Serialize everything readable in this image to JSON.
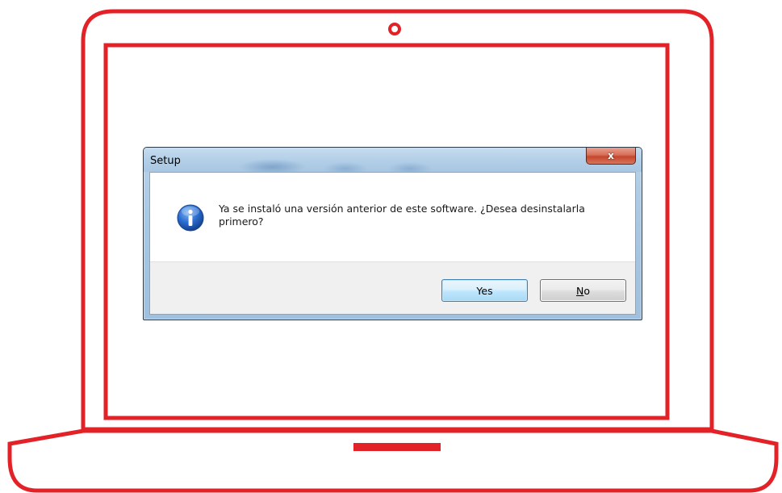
{
  "dialog": {
    "title": "Setup",
    "close_label": "x",
    "message": "Ya se instaló una versión anterior de este software. ¿Desea desinstalarla primero?",
    "message_icon": "info-icon",
    "buttons": {
      "yes_label": "Yes",
      "no_label_mnemonic": "N",
      "no_label_rest": "o"
    }
  },
  "colors": {
    "laptop_outline": "#e32228",
    "info_icon_blue": "#1f5fbf"
  }
}
